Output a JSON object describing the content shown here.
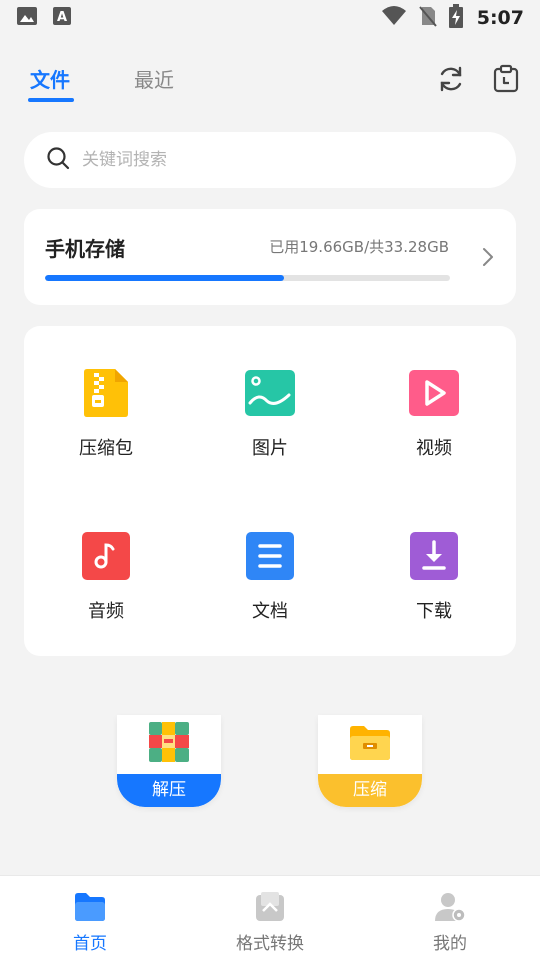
{
  "status_bar": {
    "time": "5:07",
    "left_icons": [
      "image-notification-icon",
      "text-notification-icon"
    ],
    "right_icons": [
      "wifi-icon",
      "no-sim-icon",
      "battery-charging-icon"
    ]
  },
  "header": {
    "tabs": [
      {
        "label": "文件",
        "active": true
      },
      {
        "label": "最近",
        "active": false
      }
    ],
    "icons": [
      "refresh-icon",
      "clipboard-history-icon"
    ]
  },
  "search": {
    "placeholder": "关键词搜索"
  },
  "storage": {
    "title": "手机存储",
    "usage_text": "已用19.66GB/共33.28GB",
    "used_fraction": 0.59
  },
  "categories": [
    {
      "label": "压缩包",
      "icon": "zip-archive-icon",
      "color": "#ffc107"
    },
    {
      "label": "图片",
      "icon": "image-icon",
      "color": "#26c6a6"
    },
    {
      "label": "视频",
      "icon": "video-icon",
      "color": "#ff5c8a"
    },
    {
      "label": "音频",
      "icon": "music-icon",
      "color": "#f44848"
    },
    {
      "label": "文档",
      "icon": "document-icon",
      "color": "#2f86f6"
    },
    {
      "label": "下载",
      "icon": "download-icon",
      "color": "#9f5cd6"
    }
  ],
  "quick_actions": [
    {
      "label": "解压",
      "icon": "unzip-icon",
      "color": "#1677ff"
    },
    {
      "label": "压缩",
      "icon": "compress-folder-icon",
      "color": "#fbc02d"
    }
  ],
  "bottom_nav": [
    {
      "label": "首页",
      "icon": "home-folder-icon",
      "active": true
    },
    {
      "label": "格式转换",
      "icon": "format-convert-icon",
      "active": false
    },
    {
      "label": "我的",
      "icon": "profile-icon",
      "active": false
    }
  ],
  "colors": {
    "accent": "#1677ff",
    "background": "#f3f3f3",
    "card": "#ffffff"
  }
}
